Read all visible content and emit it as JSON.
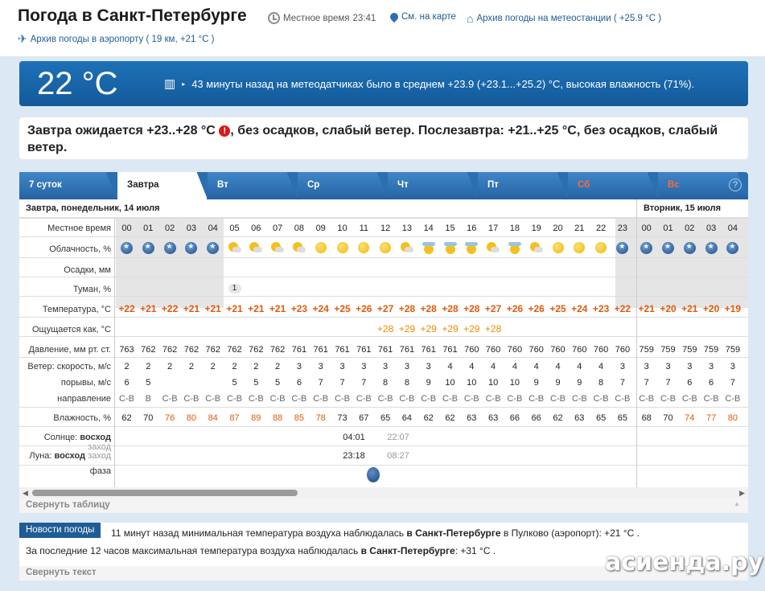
{
  "header": {
    "title": "Погода в Санкт-Петербурге",
    "local_time_label": "Местное время",
    "local_time": "23:41",
    "map_link": "См. на карте",
    "station_archive": "Архив погоды на метеостанции ( +25.9 °C )",
    "airport_archive": "Архив погоды в аэропорту ( 19 км, +21 °C )"
  },
  "now": {
    "temp": "22 °C",
    "text": "43 минуты назад на метеодатчиках было в среднем +23.9 (+23.1...+25.2) °C, высокая влажность (71%)."
  },
  "forecast_summary": {
    "part1": "Завтра ожидается +23..+28 °C",
    "warn": "!",
    "part2": ", без осадков, слабый ветер. Послезавтра: +21..+25 °C, без осадков, слабый ветер."
  },
  "tabs": [
    "7 суток",
    "Завтра",
    "Вт",
    "Ср",
    "Чт",
    "Пт",
    "Сб",
    "Вс"
  ],
  "help": "?",
  "day1_header": "Завтра, понедельник, 14 июля",
  "day2_header": "Вторник, 15 июля",
  "row_labels": {
    "time": "Местное время",
    "clouds": "Облачность, %",
    "precip": "Осадки, мм",
    "fog": "Туман, %",
    "temp": "Температура, °C",
    "feels": "Ощущается как, °C",
    "pressure": "Давление, мм рт. ст.",
    "wind_speed": "Ветер: скорость, м/с",
    "gusts": "порывы, м/с",
    "direction": "направление",
    "humidity": "Влажность, %",
    "sun_label": "Солнце:",
    "sun_rise": "восход",
    "sun_set": "заход",
    "moon_label": "Луна:",
    "moon_rise": "восход",
    "moon_set": "заход",
    "phase": "фаза"
  },
  "hours": [
    "00",
    "01",
    "02",
    "03",
    "04",
    "05",
    "06",
    "07",
    "08",
    "09",
    "10",
    "11",
    "12",
    "13",
    "14",
    "15",
    "16",
    "17",
    "18",
    "19",
    "20",
    "21",
    "22",
    "23",
    "00",
    "01",
    "02",
    "03",
    "04"
  ],
  "clouds": [
    "moon",
    "moon",
    "moon",
    "moon",
    "moon",
    "sunpc",
    "sunpc",
    "sunpc",
    "sunpc",
    "sun",
    "sun",
    "sun",
    "sun",
    "sunpc",
    "sunc",
    "sunc",
    "sunc",
    "sunpc",
    "sunc",
    "sunpc",
    "sun",
    "sun",
    "sun",
    "moon",
    "moon",
    "moon",
    "moon",
    "moon",
    "moon"
  ],
  "fog": [
    "",
    "",
    "",
    "",
    "",
    "1",
    "",
    "",
    "",
    "",
    "",
    "",
    "",
    "",
    "",
    "",
    "",
    "",
    "",
    "",
    "",
    "",
    "",
    "",
    "",
    "",
    "",
    "",
    ""
  ],
  "temps": [
    "+22",
    "+21",
    "+22",
    "+21",
    "+21",
    "+21",
    "+21",
    "+21",
    "+23",
    "+24",
    "+25",
    "+26",
    "+27",
    "+28",
    "+28",
    "+28",
    "+28",
    "+27",
    "+26",
    "+26",
    "+25",
    "+24",
    "+23",
    "+22",
    "+21",
    "+20",
    "+21",
    "+20",
    "+19"
  ],
  "feels": [
    "",
    "",
    "",
    "",
    "",
    "",
    "",
    "",
    "",
    "",
    "",
    "",
    "+28",
    "+29",
    "+29",
    "+29",
    "+29",
    "+28",
    "",
    "",
    "",
    "",
    "",
    "",
    "",
    "",
    "",
    "",
    ""
  ],
  "pressure": [
    "763",
    "762",
    "762",
    "762",
    "762",
    "762",
    "762",
    "762",
    "761",
    "761",
    "761",
    "761",
    "761",
    "761",
    "761",
    "761",
    "760",
    "760",
    "760",
    "760",
    "760",
    "760",
    "760",
    "760",
    "759",
    "759",
    "759",
    "759",
    "759"
  ],
  "wind": [
    "2",
    "2",
    "2",
    "2",
    "2",
    "2",
    "2",
    "2",
    "3",
    "3",
    "3",
    "3",
    "3",
    "3",
    "3",
    "4",
    "4",
    "4",
    "4",
    "4",
    "4",
    "4",
    "4",
    "3",
    "3",
    "3",
    "3",
    "3",
    "3"
  ],
  "gusts": [
    "6",
    "5",
    "",
    "",
    "",
    "5",
    "5",
    "5",
    "6",
    "7",
    "7",
    "7",
    "8",
    "8",
    "9",
    "10",
    "10",
    "10",
    "10",
    "9",
    "9",
    "9",
    "8",
    "7",
    "7",
    "7",
    "6",
    "6",
    "7"
  ],
  "direction": [
    "С-В",
    "В",
    "С-В",
    "С-В",
    "С-В",
    "С-В",
    "С-В",
    "С-В",
    "С-В",
    "С-В",
    "С-В",
    "С-В",
    "С-В",
    "С-В",
    "С-В",
    "С-В",
    "С-В",
    "С-В",
    "С-В",
    "С-В",
    "С-В",
    "С-В",
    "С-В",
    "С-В",
    "С-В",
    "С-В",
    "С-В",
    "С-В",
    "С-В"
  ],
  "humidity": [
    "62",
    "70",
    "76",
    "80",
    "84",
    "87",
    "89",
    "88",
    "85",
    "78",
    "73",
    "67",
    "65",
    "64",
    "62",
    "62",
    "63",
    "63",
    "66",
    "66",
    "62",
    "63",
    "65",
    "65",
    "68",
    "70",
    "74",
    "77",
    "80"
  ],
  "sun_times": {
    "rise": "04:01",
    "set": "22:07"
  },
  "moon_times": {
    "rise": "23:18",
    "set": "08:27"
  },
  "collapse_table": "Свернуть таблицу",
  "news": {
    "badge": "Новости погоды",
    "line1_a": "11 минут назад минимальная температура воздуха наблюдалась ",
    "line1_b": "в Санкт-Петербурге",
    "line1_c": " в Пулково (аэропорт): +21 °C .",
    "line2_a": "За последние 12 часов максимальная температура воздуха наблюдалась ",
    "line2_b": "в Санкт-Петербурге",
    "line2_c": ": +31 °C .",
    "collapse": "Свернуть текст"
  },
  "watermark": "асиенда.ру",
  "colors": {
    "accent": "#1e5c96",
    "temp": "#e05a0c",
    "weekend": "#ff6a3d"
  }
}
